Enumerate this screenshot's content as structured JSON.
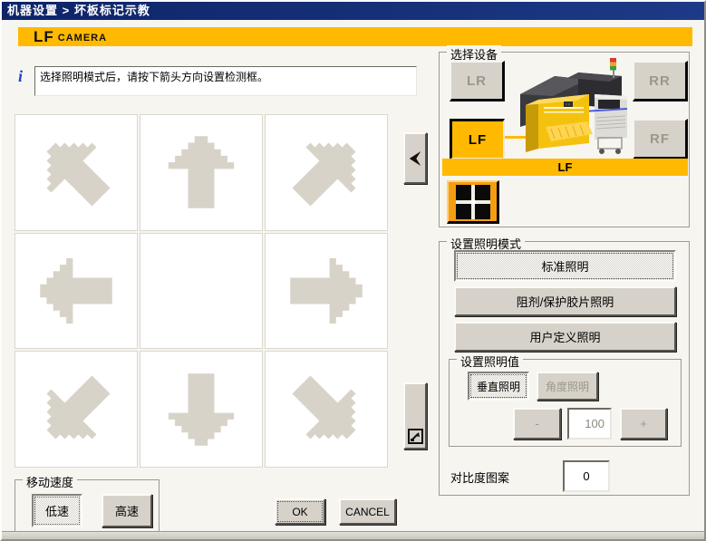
{
  "window": {
    "title": "机器设置 > 坏板标记示教"
  },
  "header": {
    "camera_id": "LF",
    "camera_word": "CAMERA"
  },
  "info": {
    "icon": "info-i-icon",
    "message": "选择照明模式后，请按下箭头方向设置检测框。"
  },
  "arrow_pad": {
    "directions": [
      "up-left",
      "up",
      "up-right",
      "left",
      "right",
      "down-left",
      "down",
      "down-right"
    ],
    "side_icons": [
      "left-arrowhead-icon",
      "set-frame-icon"
    ]
  },
  "device": {
    "group_label": "选择设备",
    "lr": "LR",
    "rr": "RR",
    "lf": "LF",
    "rf": "RF",
    "selected_label": "LF",
    "machine_icon": "smt-machine-image",
    "fiducial_icon": "fiducial-mark-icon"
  },
  "lighting_mode": {
    "group_label": "设置照明模式",
    "standard": "标准照明",
    "resist": "阻剂/保护胶片照明",
    "user": "用户定义照明"
  },
  "lighting_value": {
    "group_label": "设置照明值",
    "vertical": "垂直照明",
    "angle": "角度照明",
    "minus": "-",
    "value": "100",
    "plus": "+"
  },
  "contrast": {
    "label": "对比度图案",
    "value": "0"
  },
  "speed": {
    "group_label": "移动速度",
    "low": "低速",
    "high": "高速"
  },
  "actions": {
    "ok": "OK",
    "cancel": "CANCEL"
  },
  "colors": {
    "accent_gold": "#ffb900",
    "accent_orange": "#f59d10",
    "titlebar_navy": "#0e2468",
    "button_face": "#d6d2ca"
  }
}
